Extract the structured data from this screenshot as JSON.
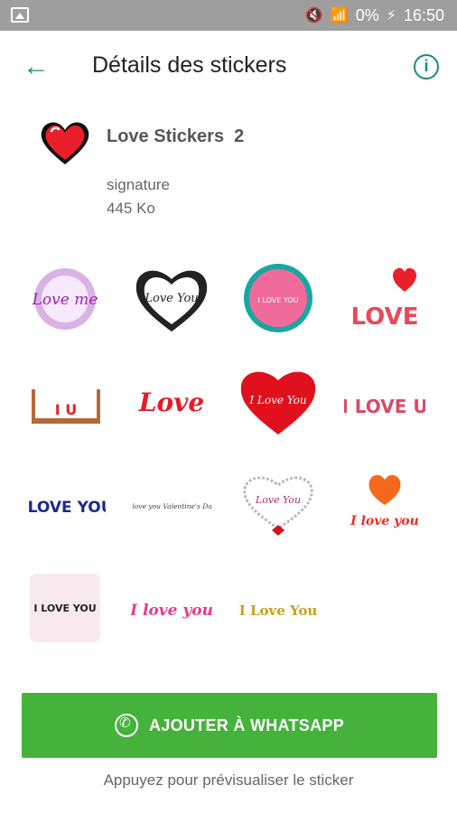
{
  "status_bar": {
    "battery": "0%",
    "time": "16:50"
  },
  "header": {
    "title": "Détails des stickers"
  },
  "pack": {
    "name": "Love Stickers  2",
    "publisher": "signature",
    "size": "445 Ko"
  },
  "stickers": [
    {
      "text": "Love me"
    },
    {
      "text": "Love You"
    },
    {
      "text": "I LOVE YOU"
    },
    {
      "text": "LOVE"
    },
    {
      "text": "I U"
    },
    {
      "text": "Love"
    },
    {
      "text": "I Love You"
    },
    {
      "text": "I LOVE U"
    },
    {
      "text": "I LOVE YOU"
    },
    {
      "text": "I love you Valentine's Day"
    },
    {
      "text": "Love You"
    },
    {
      "text": "I love you"
    },
    {
      "text": "I LOVE YOU"
    },
    {
      "text": "I love you"
    },
    {
      "text": "I Love You"
    }
  ],
  "actions": {
    "add_label": "AJOUTER À WHATSAPP",
    "hint": "Appuyez pour prévisualiser le sticker"
  },
  "colors": {
    "accent": "#1b8a7a",
    "cta": "#45b23b",
    "statusbar": "#9e9e9e",
    "heart": "#e8202a"
  }
}
